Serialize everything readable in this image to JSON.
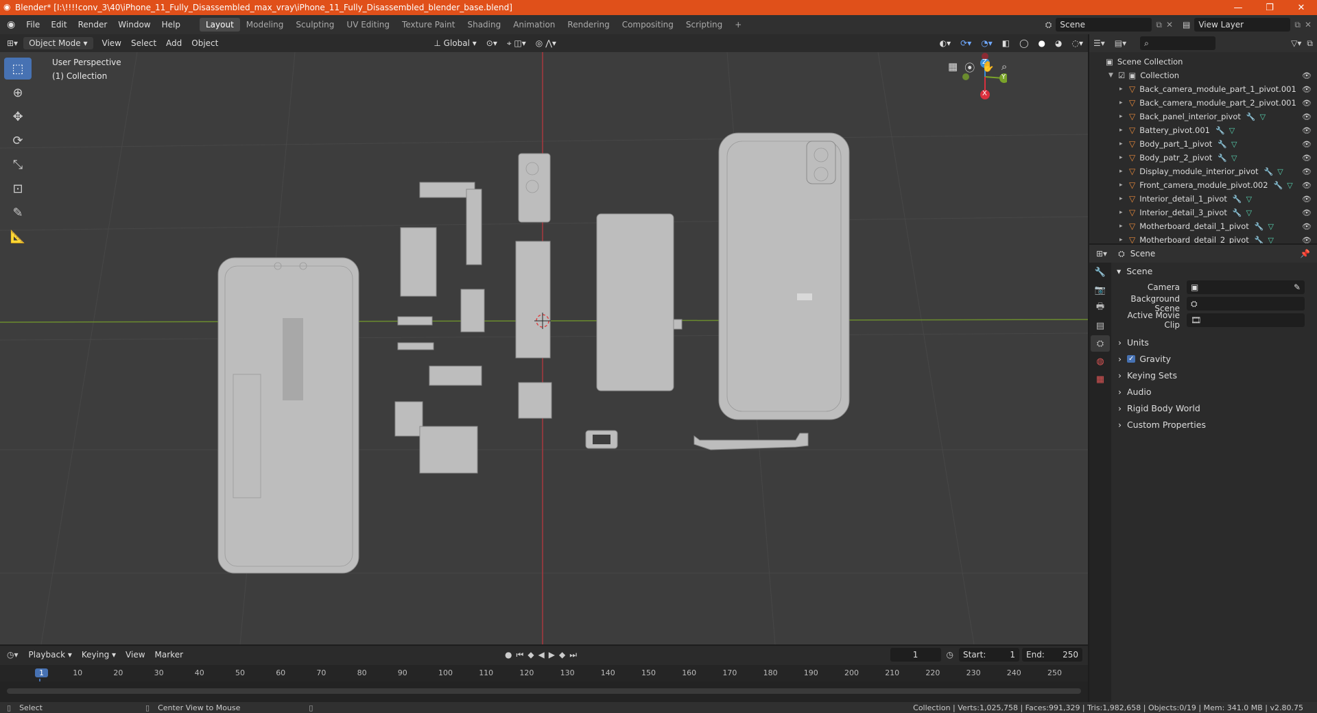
{
  "window": {
    "title": "Blender* [I:\\!!!!conv_3\\40\\iPhone_11_Fully_Disassembled_max_vray\\iPhone_11_Fully_Disassembled_blender_base.blend]",
    "minimize": "—",
    "maximize": "❐",
    "close": "✕"
  },
  "menu": {
    "items": [
      "File",
      "Edit",
      "Render",
      "Window",
      "Help"
    ]
  },
  "workspaces": [
    "Layout",
    "Modeling",
    "Sculpting",
    "UV Editing",
    "Texture Paint",
    "Shading",
    "Animation",
    "Rendering",
    "Compositing",
    "Scripting"
  ],
  "add_workspace": "+",
  "scene_field": "Scene",
  "view_layer_field": "View Layer",
  "viewport_header": {
    "mode": "Object Mode",
    "view": "View",
    "select": "Select",
    "add": "Add",
    "object": "Object",
    "orientation": "Global"
  },
  "overlay": {
    "line1": "User Perspective",
    "line2": "(1) Collection"
  },
  "gizmo": {
    "z": "Z",
    "y": "Y",
    "x": "X"
  },
  "outliner": {
    "search_placeholder": "",
    "scene_collection": "Scene Collection",
    "collection": "Collection",
    "items": [
      "Back_camera_module_part_1_pivot.001",
      "Back_camera_module_part_2_pivot.001",
      "Back_panel_interior_pivot",
      "Battery_pivot.001",
      "Body_part_1_pivot",
      "Body_patr_2_pivot",
      "Display_module_interior_pivot",
      "Front_camera_module_pivot.002",
      "Interior_detail_1_pivot",
      "Interior_detail_3_pivot",
      "Motherboard_detail_1_pivot",
      "Motherboard_detail_2_pivot"
    ]
  },
  "properties": {
    "context": "Scene",
    "panel": "Scene",
    "camera_label": "Camera",
    "background_scene_label": "Background Scene",
    "active_movie_clip_label": "Active Movie Clip",
    "sections": [
      "Units",
      "Gravity",
      "Keying Sets",
      "Audio",
      "Rigid Body World",
      "Custom Properties"
    ],
    "gravity_checked": true
  },
  "timeline": {
    "playback": "Playback",
    "keying": "Keying",
    "view": "View",
    "marker": "Marker",
    "current_frame": "1",
    "start_label": "Start:",
    "start": "1",
    "end_label": "End:",
    "end": "250",
    "ruler": [
      "1",
      "10",
      "20",
      "30",
      "40",
      "50",
      "60",
      "70",
      "80",
      "90",
      "100",
      "110",
      "120",
      "130",
      "140",
      "150",
      "160",
      "170",
      "180",
      "190",
      "200",
      "210",
      "220",
      "230",
      "240",
      "250"
    ]
  },
  "status": {
    "select": "Select",
    "center_view": "Center View to Mouse",
    "stats": "Collection | Verts:1,025,758 | Faces:991,329 | Tris:1,982,658 | Objects:0/19 | Mem: 341.0 MB | v2.80.75"
  },
  "colors": {
    "title_bar": "#e0501a",
    "accent": "#4772b3",
    "x_axis": "#d9303e",
    "y_axis": "#7aa32a",
    "z_axis": "#3a8fd9"
  }
}
